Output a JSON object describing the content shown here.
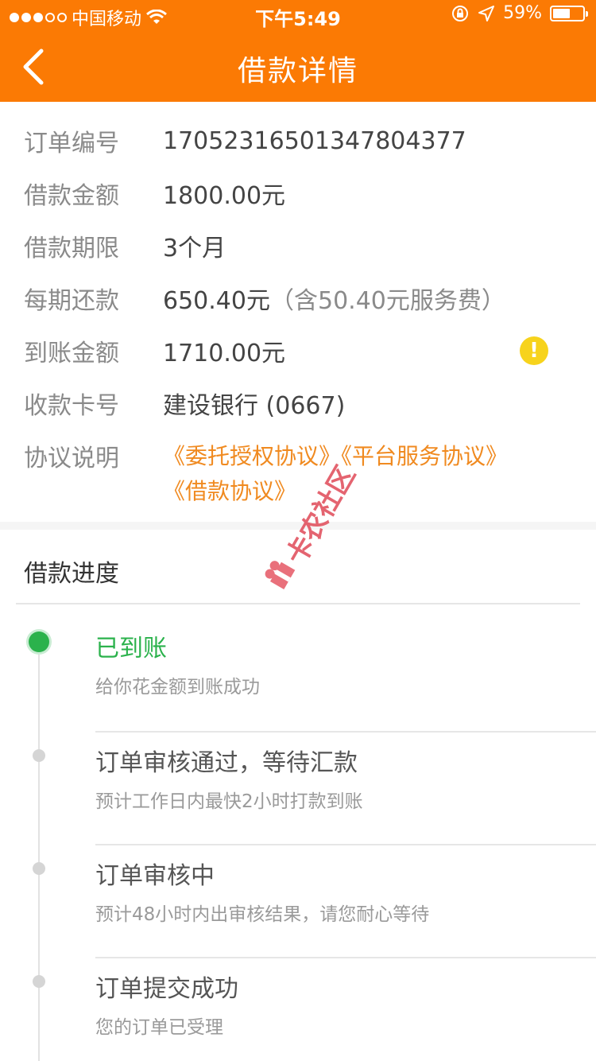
{
  "status_bar": {
    "carrier": "中国移动",
    "time": "下午5:49",
    "battery_pct_text": "59%",
    "battery_level": 0.59,
    "signal_bars_filled": 3,
    "signal_bars_total": 5
  },
  "nav": {
    "title": "借款详情",
    "back_icon": "chevron-left-icon"
  },
  "details": [
    {
      "label": "订单编号",
      "value": "17052316501347804377"
    },
    {
      "label": "借款金额",
      "value": "1800.00元"
    },
    {
      "label": "借款期限",
      "value": "3个月"
    },
    {
      "label": "每期还款",
      "value": "650.40元",
      "extra": "（含50.40元服务费）"
    },
    {
      "label": "到账金额",
      "value": "1710.00元",
      "icon": "warning-icon",
      "icon_text": "!"
    },
    {
      "label": "收款卡号",
      "value": "建设银行 (0667)"
    },
    {
      "label": "协议说明"
    }
  ],
  "agreements": [
    "《委托授权协议》",
    "《平台服务协议》",
    "《借款协议》"
  ],
  "progress": {
    "title": "借款进度",
    "steps": [
      {
        "title": "已到账",
        "desc": "给你花金额到账成功",
        "active": true
      },
      {
        "title": "订单审核通过，等待汇款",
        "desc": "预计工作日内最快2小时打款到账",
        "active": false
      },
      {
        "title": "订单审核中",
        "desc": "预计48小时内出审核结果，请您耐心等待",
        "active": false
      },
      {
        "title": "订单提交成功",
        "desc": "您的订单已受理",
        "active": false
      }
    ]
  },
  "watermark": {
    "text": "卡农社区",
    "icon": "gift-logo-icon"
  },
  "colors": {
    "brand": "#fb7a04",
    "success": "#2bb24c",
    "link": "#f08a20",
    "warning": "#f7d31c"
  }
}
